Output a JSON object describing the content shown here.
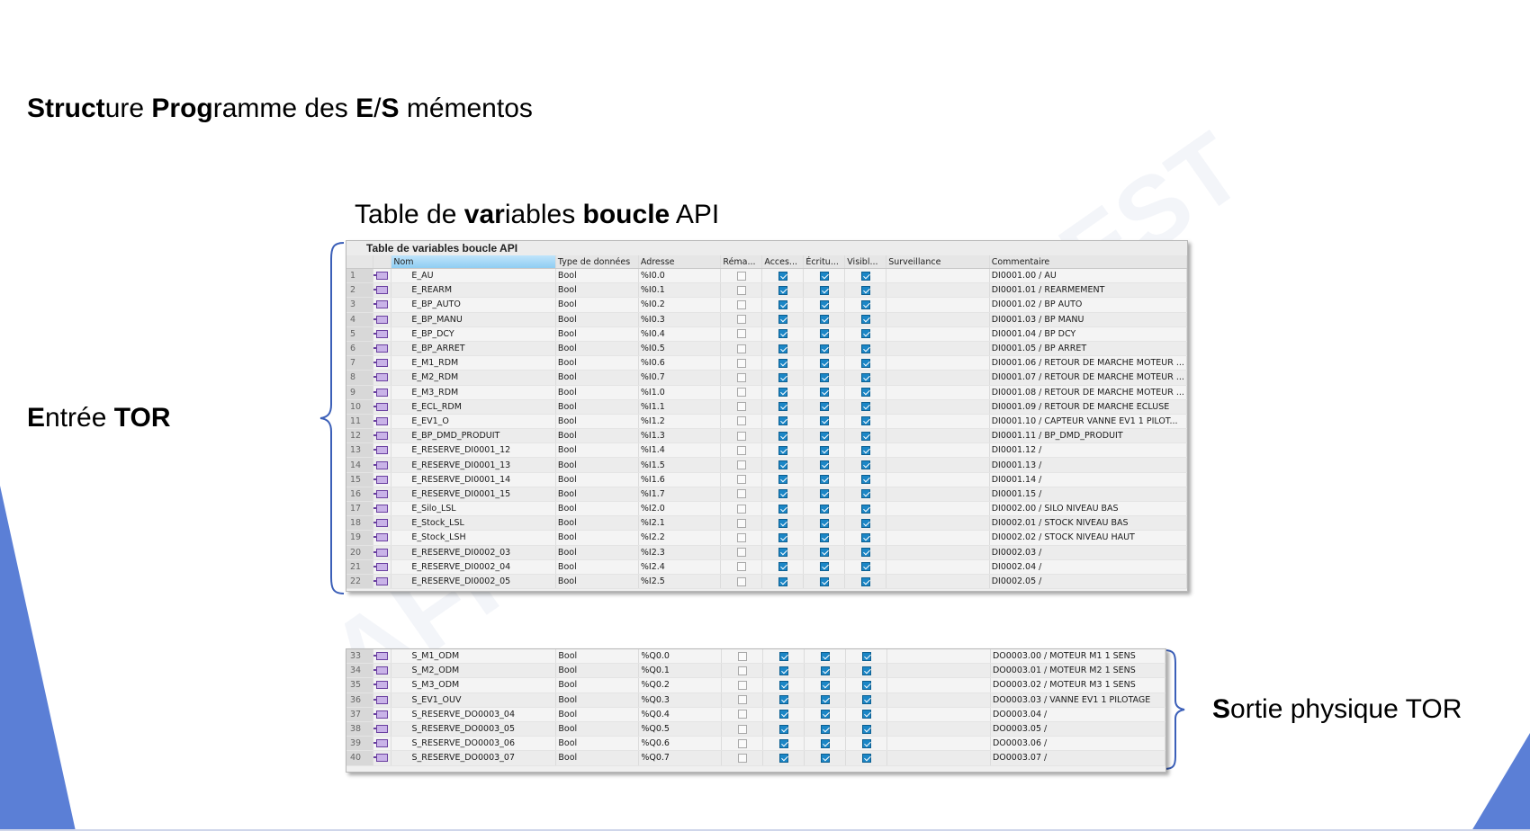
{
  "slide": {
    "title_parts": [
      {
        "text": "Struct",
        "bold": true
      },
      {
        "text": "ure ",
        "bold": false
      },
      {
        "text": "Prog",
        "bold": true
      },
      {
        "text": "ramme des ",
        "bold": false
      },
      {
        "text": "E",
        "bold": true
      },
      {
        "text": "/",
        "bold": false
      },
      {
        "text": "S",
        "bold": true
      },
      {
        "text": " mémentos",
        "bold": false
      }
    ],
    "caption_parts": [
      {
        "text": "Table de ",
        "bold": false
      },
      {
        "text": "var",
        "bold": true
      },
      {
        "text": "iables ",
        "bold": false
      },
      {
        "text": "boucle",
        "bold": true
      },
      {
        "text": " API",
        "bold": false
      }
    ],
    "input_label_parts": [
      {
        "text": "E",
        "bold": true
      },
      {
        "text": "ntrée ",
        "bold": false
      },
      {
        "text": "TOR",
        "bold": true
      }
    ],
    "output_label_parts": [
      {
        "text": "S",
        "bold": true
      },
      {
        "text": "ortie physique TOR",
        "bold": false
      }
    ],
    "watermark_1": "AFI",
    "watermark_2": "OUEST",
    "accent_color": "#5b7fd6"
  },
  "table_window": {
    "title": "Table de variables boucle API",
    "headers": [
      "",
      "",
      "Nom",
      "Type de données",
      "Adresse",
      "Réma...",
      "Acces...",
      "Écritu...",
      "Visibl...",
      "Surveillance",
      "Commentaire"
    ],
    "icon": "tag-variable-icon"
  },
  "inputs": [
    {
      "n": "1",
      "name": "E_AU",
      "type": "Bool",
      "addr": "%I0.0",
      "c": "DI0001.00 / AU"
    },
    {
      "n": "2",
      "name": "E_REARM",
      "type": "Bool",
      "addr": "%I0.1",
      "c": "DI0001.01 / REARMEMENT"
    },
    {
      "n": "3",
      "name": "E_BP_AUTO",
      "type": "Bool",
      "addr": "%I0.2",
      "c": "DI0001.02 / BP AUTO"
    },
    {
      "n": "4",
      "name": "E_BP_MANU",
      "type": "Bool",
      "addr": "%I0.3",
      "c": "DI0001.03 / BP MANU"
    },
    {
      "n": "5",
      "name": "E_BP_DCY",
      "type": "Bool",
      "addr": "%I0.4",
      "c": "DI0001.04 / BP DCY"
    },
    {
      "n": "6",
      "name": "E_BP_ARRET",
      "type": "Bool",
      "addr": "%I0.5",
      "c": "DI0001.05 / BP ARRET"
    },
    {
      "n": "7",
      "name": "E_M1_RDM",
      "type": "Bool",
      "addr": "%I0.6",
      "c": "DI0001.06 / RETOUR DE MARCHE MOTEUR ..."
    },
    {
      "n": "8",
      "name": "E_M2_RDM",
      "type": "Bool",
      "addr": "%I0.7",
      "c": "DI0001.07 / RETOUR DE MARCHE MOTEUR ..."
    },
    {
      "n": "9",
      "name": "E_M3_RDM",
      "type": "Bool",
      "addr": "%I1.0",
      "c": "DI0001.08 / RETOUR DE MARCHE MOTEUR ..."
    },
    {
      "n": "10",
      "name": "E_ECL_RDM",
      "type": "Bool",
      "addr": "%I1.1",
      "c": "DI0001.09 / RETOUR DE MARCHE ECLUSE"
    },
    {
      "n": "11",
      "name": "E_EV1_O",
      "type": "Bool",
      "addr": "%I1.2",
      "c": "DI0001.10 / CAPTEUR VANNE EV1 1 PILOT..."
    },
    {
      "n": "12",
      "name": "E_BP_DMD_PRODUIT",
      "type": "Bool",
      "addr": "%I1.3",
      "c": "DI0001.11 / BP_DMD_PRODUIT"
    },
    {
      "n": "13",
      "name": "E_RESERVE_DI0001_12",
      "type": "Bool",
      "addr": "%I1.4",
      "c": "DI0001.12 /"
    },
    {
      "n": "14",
      "name": "E_RESERVE_DI0001_13",
      "type": "Bool",
      "addr": "%I1.5",
      "c": "DI0001.13 /"
    },
    {
      "n": "15",
      "name": "E_RESERVE_DI0001_14",
      "type": "Bool",
      "addr": "%I1.6",
      "c": "DI0001.14 /"
    },
    {
      "n": "16",
      "name": "E_RESERVE_DI0001_15",
      "type": "Bool",
      "addr": "%I1.7",
      "c": "DI0001.15 /"
    },
    {
      "n": "17",
      "name": "E_Silo_LSL",
      "type": "Bool",
      "addr": "%I2.0",
      "c": "DI0002.00 / SILO NIVEAU BAS"
    },
    {
      "n": "18",
      "name": "E_Stock_LSL",
      "type": "Bool",
      "addr": "%I2.1",
      "c": "DI0002.01 / STOCK NIVEAU BAS"
    },
    {
      "n": "19",
      "name": "E_Stock_LSH",
      "type": "Bool",
      "addr": "%I2.2",
      "c": "DI0002.02 / STOCK NIVEAU HAUT"
    },
    {
      "n": "20",
      "name": "E_RESERVE_DI0002_03",
      "type": "Bool",
      "addr": "%I2.3",
      "c": "DI0002.03 /"
    },
    {
      "n": "21",
      "name": "E_RESERVE_DI0002_04",
      "type": "Bool",
      "addr": "%I2.4",
      "c": "DI0002.04 /"
    },
    {
      "n": "22",
      "name": "E_RESERVE_DI0002_05",
      "type": "Bool",
      "addr": "%I2.5",
      "c": "DI0002.05 /"
    }
  ],
  "outputs": [
    {
      "n": "33",
      "name": "S_M1_ODM",
      "type": "Bool",
      "addr": "%Q0.0",
      "c": "DO0003.00 / MOTEUR M1  1 SENS"
    },
    {
      "n": "34",
      "name": "S_M2_ODM",
      "type": "Bool",
      "addr": "%Q0.1",
      "c": "DO0003.01 / MOTEUR M2  1 SENS"
    },
    {
      "n": "35",
      "name": "S_M3_ODM",
      "type": "Bool",
      "addr": "%Q0.2",
      "c": "DO0003.02 / MOTEUR M3  1 SENS"
    },
    {
      "n": "36",
      "name": "S_EV1_OUV",
      "type": "Bool",
      "addr": "%Q0.3",
      "c": "DO0003.03 / VANNE EV1  1 PILOTAGE"
    },
    {
      "n": "37",
      "name": "S_RESERVE_DO0003_04",
      "type": "Bool",
      "addr": "%Q0.4",
      "c": "DO0003.04 /"
    },
    {
      "n": "38",
      "name": "S_RESERVE_DO0003_05",
      "type": "Bool",
      "addr": "%Q0.5",
      "c": "DO0003.05 /"
    },
    {
      "n": "39",
      "name": "S_RESERVE_DO0003_06",
      "type": "Bool",
      "addr": "%Q0.6",
      "c": "DO0003.06 /"
    },
    {
      "n": "40",
      "name": "S_RESERVE_DO0003_07",
      "type": "Bool",
      "addr": "%Q0.7",
      "c": "DO0003.07 /"
    }
  ],
  "checkbox_states": {
    "retain": false,
    "accessible": true,
    "writable": true,
    "visible": true
  }
}
